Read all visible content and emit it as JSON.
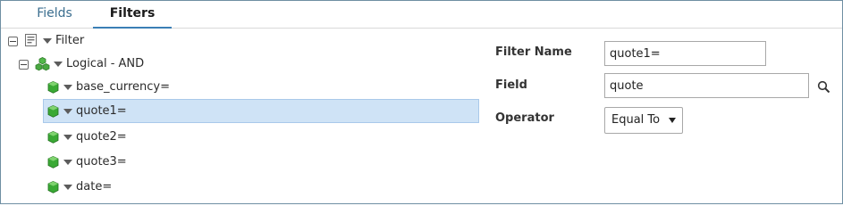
{
  "tabs": [
    {
      "label": "Fields",
      "active": false
    },
    {
      "label": "Filters",
      "active": true
    }
  ],
  "tree": {
    "root": {
      "label": "Filter",
      "icon": "filter-document-icon"
    },
    "group": {
      "label": "Logical - AND",
      "icon": "logical-group-cubes-icon"
    },
    "items": [
      {
        "label": "base_currency=",
        "icon": "green-cube-icon",
        "selected": false
      },
      {
        "label": "quote1=",
        "icon": "green-cube-icon",
        "selected": true
      },
      {
        "label": "quote2=",
        "icon": "green-cube-icon",
        "selected": false
      },
      {
        "label": "quote3=",
        "icon": "green-cube-icon",
        "selected": false
      },
      {
        "label": "date=",
        "icon": "green-cube-icon",
        "selected": false
      }
    ]
  },
  "form": {
    "filter_name_label": "Filter Name",
    "filter_name_value": "quote1=",
    "field_label": "Field",
    "field_value": "quote",
    "operator_label": "Operator",
    "operator_value": "Equal To"
  },
  "colors": {
    "accent": "#3a7fb5",
    "selection": "#cfe3f6",
    "cube_green": "#3aa935"
  }
}
